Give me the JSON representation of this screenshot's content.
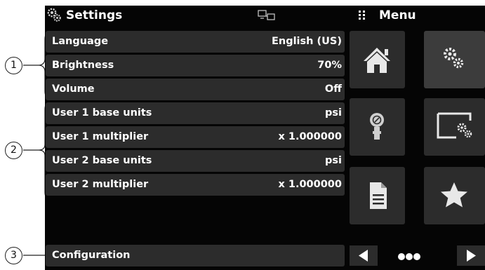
{
  "header": {
    "title": "Settings",
    "menu_label": "Menu"
  },
  "settings_rows": [
    {
      "label": "Language",
      "value": "English (US)"
    },
    {
      "label": "Brightness",
      "value": "70%"
    },
    {
      "label": "Volume",
      "value": "Off"
    },
    {
      "label": "User 1 base units",
      "value": "psi"
    },
    {
      "label": "User 1 multiplier",
      "value": "x 1.000000"
    },
    {
      "label": "User 2 base units",
      "value": "psi"
    },
    {
      "label": "User 2 multiplier",
      "value": "x 1.000000"
    }
  ],
  "footer": {
    "configuration_label": "Configuration"
  },
  "menu_tiles": [
    {
      "icon": "home-icon"
    },
    {
      "icon": "settings-gears-icon",
      "active": true
    },
    {
      "icon": "pressure-gauge-icon"
    },
    {
      "icon": "display-settings-icon"
    },
    {
      "icon": "document-icon"
    },
    {
      "icon": "star-icon"
    }
  ],
  "callouts": [
    "1",
    "2",
    "3"
  ],
  "colors": {
    "background": "#050505",
    "row": "#2c2c2c",
    "active_tile": "#3c3c3c",
    "text": "#ffffff"
  }
}
